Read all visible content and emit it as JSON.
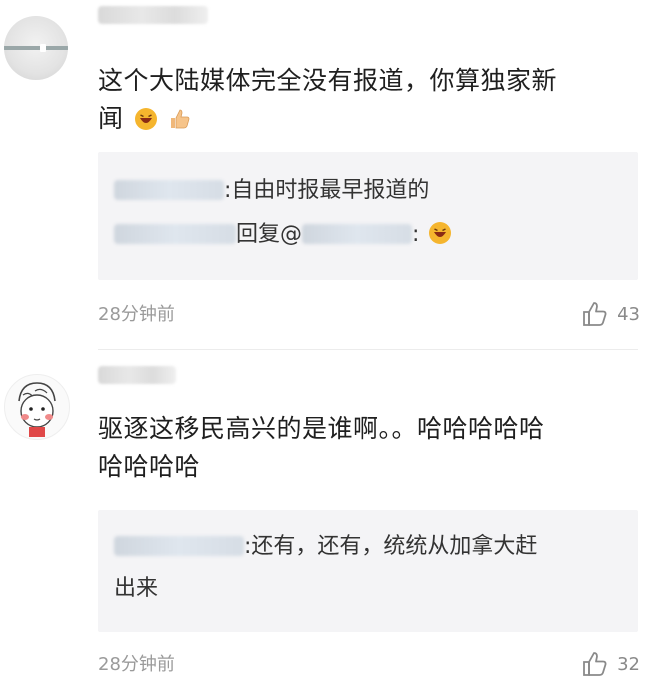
{
  "comments": [
    {
      "text_line1": "这个大陆媒体完全没有报道，你算独家新",
      "text_line2": "闻",
      "replies": [
        {
          "text": ":自由时报最早报道的"
        },
        {
          "mid": "回复@",
          "suffix": ":"
        }
      ],
      "time": "28分钟前",
      "likes": "43"
    },
    {
      "text_line1": "驱逐这移民高兴的是谁啊。。哈哈哈哈哈",
      "text_line2": "哈哈哈哈",
      "replies": [
        {
          "text": ":还有，还有，统统从加拿大赶",
          "text2": "出来"
        }
      ],
      "time": "28分钟前",
      "likes": "32"
    }
  ],
  "colors": {
    "meta": "#9a9a9a",
    "reply_bg": "#f4f4f6",
    "text": "#1f1f1f"
  },
  "icons": {
    "laugh": "laugh-emoji-icon",
    "thumb": "thumbs-up-emoji-icon",
    "like": "like-outline-icon"
  }
}
